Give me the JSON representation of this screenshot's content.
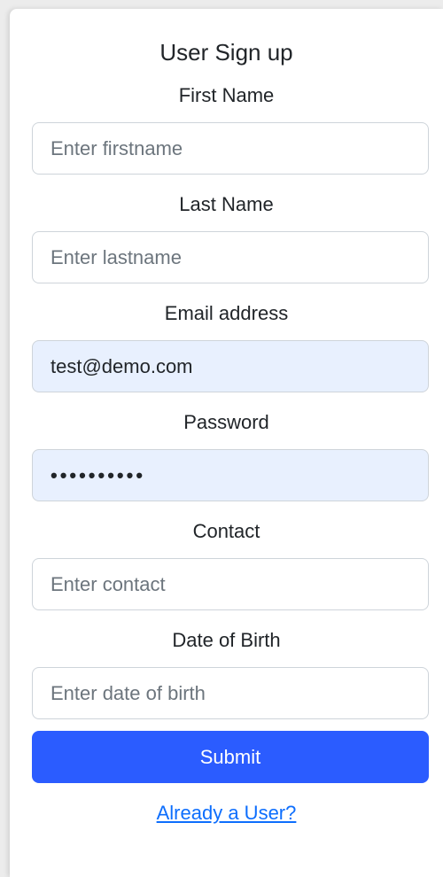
{
  "form": {
    "title": "User Sign up",
    "fields": [
      {
        "label": "First Name",
        "placeholder": "Enter firstname",
        "value": ""
      },
      {
        "label": "Last Name",
        "placeholder": "Enter lastname",
        "value": ""
      },
      {
        "label": "Email address",
        "placeholder": "",
        "value": "test@demo.com"
      },
      {
        "label": "Password",
        "placeholder": "",
        "value": "••••••••••"
      },
      {
        "label": "Contact",
        "placeholder": "Enter contact",
        "value": ""
      },
      {
        "label": "Date of Birth",
        "placeholder": "Enter date of birth",
        "value": ""
      }
    ],
    "submit_label": "Submit",
    "login_link": "Already a User?"
  },
  "colors": {
    "accent": "#2b5cff",
    "autofill_bg": "#e8f0fe",
    "link": "#0d6efd"
  }
}
